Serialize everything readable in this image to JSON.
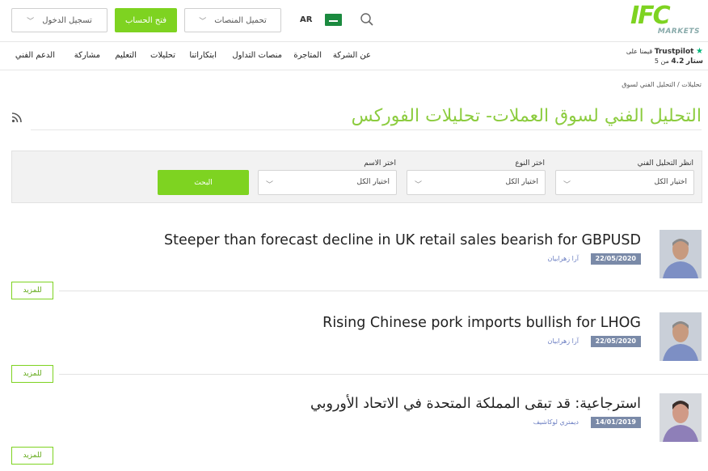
{
  "header": {
    "login_label": "تسجيل الدخول",
    "open_account_label": "فتح الحساب",
    "platforms_label": "تحميل المنصات",
    "lang_label": "AR",
    "logo_text": "IFC",
    "logo_sub": "MARKETS",
    "accent_color": "#7ed321"
  },
  "nav": {
    "items": [
      "عن الشركة",
      "المتاجرة",
      "منصات التداول",
      "ابتكاراتنا",
      "تحليلات",
      "التعليم",
      "مشاركة",
      "الدعم الفني"
    ],
    "trust_line1": "قيمنا على",
    "trust_brand": "Trustpilot",
    "trust_line2_prefix": "ستار",
    "trust_score": "4.2",
    "trust_line2_suffix": "من 5"
  },
  "breadcrumb": {
    "items": [
      "تحليلات",
      "التحليل الفني لسوق"
    ],
    "separator": "/"
  },
  "page": {
    "title": "التحليل الفني لسوق العملات- تحليلات الفوركس"
  },
  "filter": {
    "analysis_label": "انظر التحليل الفني",
    "analysis_value": "اختيار الكل",
    "type_label": "اختر النوع",
    "type_value": "اختيار الكل",
    "name_label": "اختر الاسم",
    "name_value": "اختيار الكل",
    "search_label": "البحث"
  },
  "articles": [
    {
      "title": "Steeper than forecast decline in UK retail sales bearish for GBPUSD",
      "date": "22/05/2020",
      "author": "آرا زهرابيان",
      "more": "للمزيد"
    },
    {
      "title": "Rising Chinese pork imports bullish for LHOG",
      "date": "22/05/2020",
      "author": "آرا زهرابيان",
      "more": "للمزيد"
    },
    {
      "title": "استرجاعية: قد تبقى المملكة المتحدة في الاتحاد الأوروبي",
      "date": "14/01/2019",
      "author": "ديمتري لوكاشيف",
      "more": "للمزيد"
    }
  ]
}
